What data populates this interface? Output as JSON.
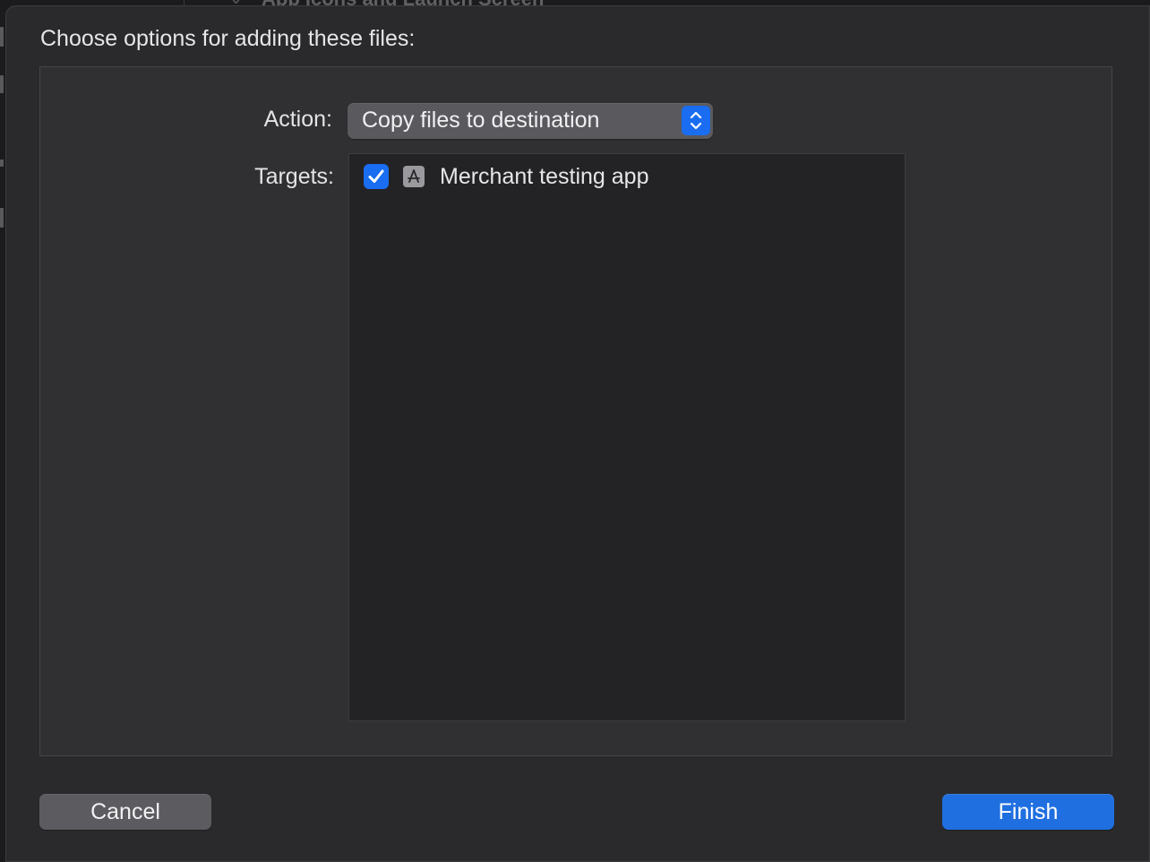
{
  "background_window": {
    "partial_title": "App Icons and Launch Screen"
  },
  "sheet": {
    "title": "Choose options for adding these files:",
    "action": {
      "label": "Action:",
      "selected_value": "Copy files to destination",
      "icon": "chevron-up-down-icon"
    },
    "targets": {
      "label": "Targets:",
      "items": [
        {
          "name": "Merchant testing app",
          "checked": true,
          "icon": "app-store-icon"
        }
      ]
    },
    "buttons": {
      "cancel_label": "Cancel",
      "finish_label": "Finish"
    }
  },
  "colors": {
    "accent": "#1a6df0",
    "sheet_background": "#2a2a2c",
    "panel_background": "#303032",
    "list_background": "#232326"
  }
}
